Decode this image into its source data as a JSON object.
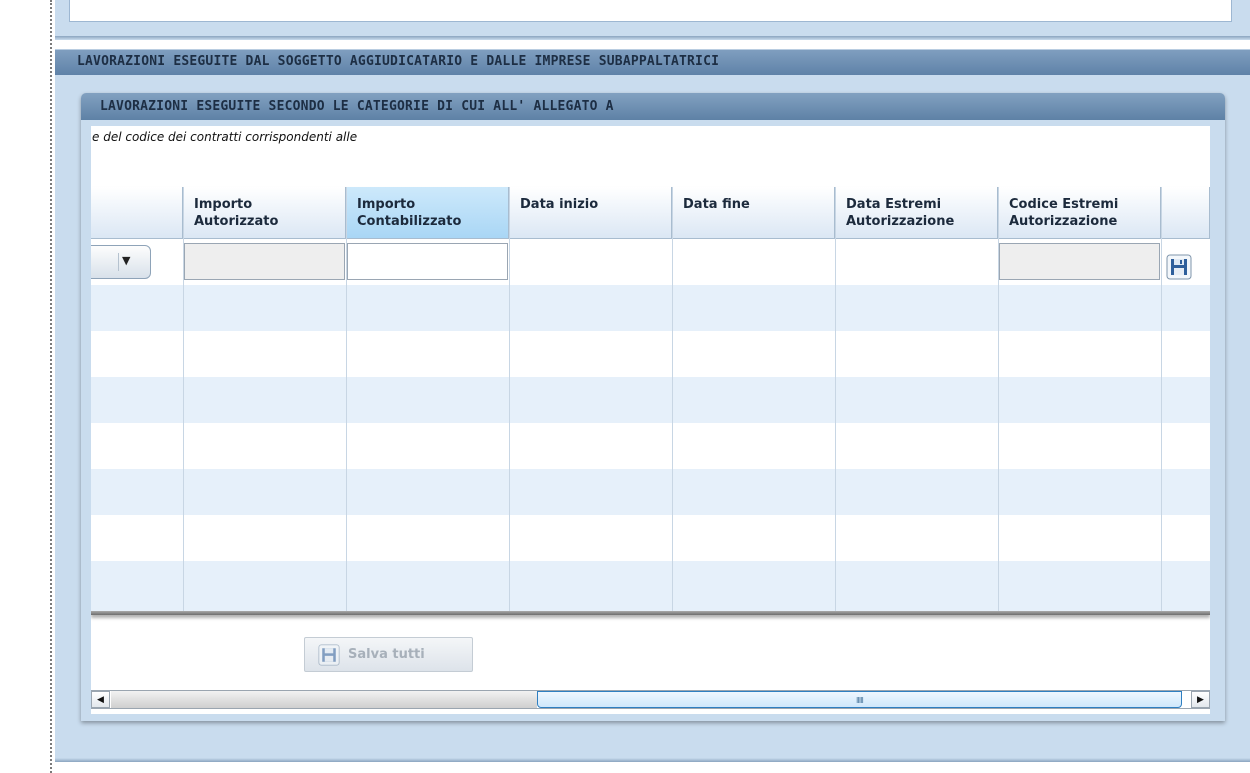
{
  "panel": {
    "title": "LAVORAZIONI ESEGUITE DAL SOGGETTO AGGIUDICATARIO E DALLE IMPRESE SUBAPPALTATRICI"
  },
  "subpanel": {
    "title": "LAVORAZIONI ESEGUITE SECONDO LE CATEGORIE DI CUI ALL' ALLEGATO A",
    "description": "e del codice dei contratti corrispondenti alle"
  },
  "grid": {
    "columns": [
      "",
      "Importo\nAutorizzato",
      "Importo\nContabilizzato",
      "Data inizio",
      "Data fine",
      "Data Estremi\nAutorizzazione",
      "Codice Estremi\nAutorizzazione",
      ""
    ],
    "highlighted_column": "Importo Contabilizzato",
    "dropdown_arrow": "▼",
    "row_save_icon": "floppy-disk-icon"
  },
  "actions": {
    "save_all_label": "Salva tutti",
    "save_all_icon": "floppy-disk-icon"
  },
  "scrollbar": {
    "left_arrow": "◀",
    "right_arrow": "▶",
    "grip": "IIIII"
  },
  "colors": {
    "header_bar": "#6a8bb0",
    "panel_bg": "#c9dcee",
    "row_alt": "#e6f0fa",
    "highlight_header": "#b3dcf7"
  }
}
